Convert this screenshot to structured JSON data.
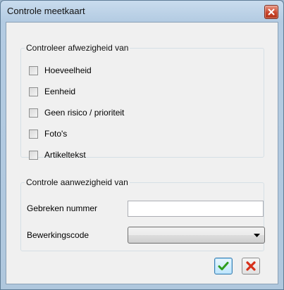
{
  "window": {
    "title": "Controle meetkaart"
  },
  "group_deviation": {
    "legend": "Controleer afwezigheid van",
    "options": [
      {
        "label": "Hoeveelheid",
        "checked": false
      },
      {
        "label": "Eenheid",
        "checked": false
      },
      {
        "label": "Geen risico / prioriteit",
        "checked": false
      },
      {
        "label": "Foto's",
        "checked": false
      },
      {
        "label": "Artikeltekst",
        "checked": false
      }
    ]
  },
  "group_presence": {
    "legend": "Controle aanwezigheid van",
    "defects_label": "Gebreken nummer",
    "defects_value": "",
    "processing_label": "Bewerkingscode",
    "processing_value": ""
  },
  "buttons": {
    "ok_icon": "green-checkmark-icon",
    "cancel_icon": "red-x-icon"
  },
  "colors": {
    "ok_green": "#2e9e1f",
    "cancel_red": "#d6301a"
  }
}
